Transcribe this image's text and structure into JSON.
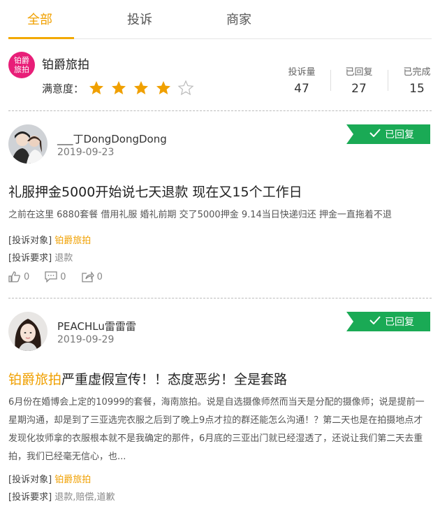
{
  "tabs": [
    {
      "label": "全部"
    },
    {
      "label": "投诉"
    },
    {
      "label": "商家"
    }
  ],
  "merchant": {
    "logo_text_1": "铂爵",
    "logo_text_2": "旅拍",
    "name": "铂爵旅拍",
    "satisfaction_label": "满意度：",
    "rating": 4,
    "rating_max": 5,
    "stats": [
      {
        "label": "投诉量",
        "value": "47"
      },
      {
        "label": "已回复",
        "value": "27"
      },
      {
        "label": "已完成",
        "value": "15"
      }
    ]
  },
  "complaints": [
    {
      "user": "___丁DongDongDong",
      "date": "2019-09-23",
      "status": "已回复",
      "title": "礼服押金5000开始说七天退款 现在又15个工作日",
      "title_highlight": "",
      "body": "之前在这里 6880套餐 借用礼服 婚礼前期 交了5000押金 9.14当日快递归还 押金一直拖着不退",
      "target_label": "[投诉对象]",
      "target_value": "铂爵旅拍",
      "request_label": "[投诉要求]",
      "request_value": "退款",
      "likes": "0",
      "comments": "0",
      "shares": "0"
    },
    {
      "user": "PEACHLu雷雷雷",
      "date": "2019-09-29",
      "status": "已回复",
      "title_highlight": "铂爵旅拍",
      "title": "严重虚假宣传！！态度恶劣！全是套路",
      "body": "6月份在婚博会上定的10999的套餐，海南旅拍。说是自选摄像师然而当天是分配的摄像师；说是提前一星期沟通，却是到了三亚选完衣服之后到了晚上9点才拉的群还能怎么沟通！？第二天也是在拍摄地点才发现化妆师拿的衣服根本就不是我确定的那件，6月底的三亚出门就已经湿透了，还说让我们第二天去重拍，我们已经毫无信心，也...",
      "target_label": "[投诉对象]",
      "target_value": "铂爵旅拍",
      "request_label": "[投诉要求]",
      "request_value": "退款,赔偿,道歉"
    }
  ],
  "colors": {
    "accent": "#f0a000",
    "status_green": "#1aaa55",
    "logo_pink": "#e81e78"
  }
}
